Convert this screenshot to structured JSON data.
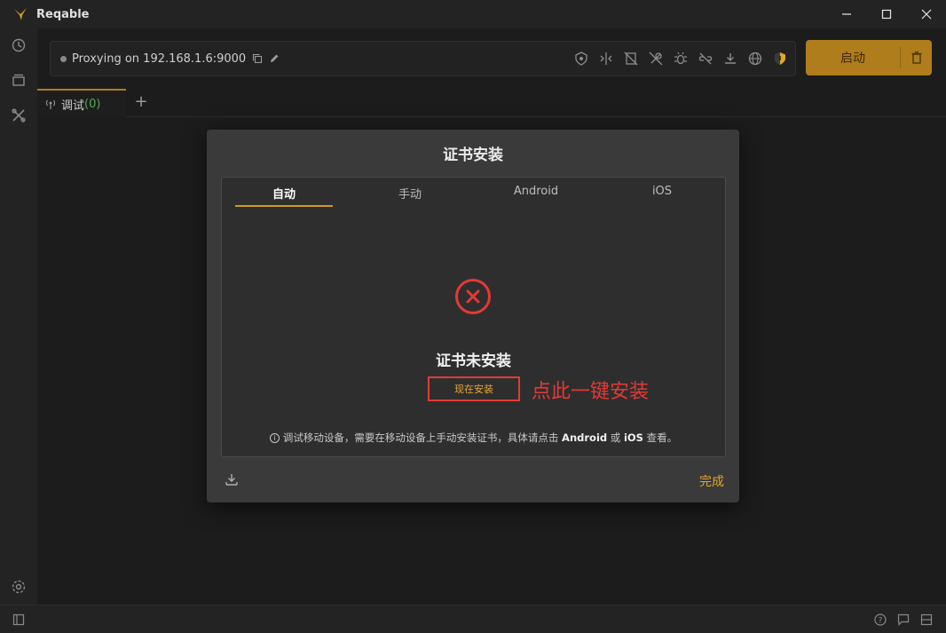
{
  "window": {
    "title": "Reqable",
    "controls": {
      "minimize": "—",
      "maximize": "☐",
      "close": "✕"
    }
  },
  "rail": {
    "icons": [
      "history-icon",
      "layers-icon",
      "tools-icon",
      "settings-icon"
    ]
  },
  "proxy": {
    "status_text": "Proxying on 192.168.1.6:9000",
    "tool_icons": [
      "lock-shield-icon",
      "split-icon",
      "no-cache-icon",
      "no-ssl-icon",
      "bug-icon",
      "link-break-icon",
      "download-icon",
      "globe-icon",
      "shield-warning-icon"
    ]
  },
  "start_button": {
    "label": "启动"
  },
  "tabs": [
    {
      "label": "调试",
      "count": "(0)"
    }
  ],
  "add_tab": "+",
  "dialog": {
    "title": "证书安装",
    "tabs": [
      "自动",
      "手动",
      "Android",
      "iOS"
    ],
    "active_tab": 0,
    "status": "证书未安装",
    "install_button": "现在安装",
    "annotation": "点此一键安装",
    "hint_prefix": "调试移动设备，需要在移动设备上手动安装证书，具体请点击",
    "hint_android": "Android",
    "hint_or": "或",
    "hint_ios": "iOS",
    "hint_suffix": "查看。",
    "done_button": "完成"
  },
  "colors": {
    "accent": "#b07d1c",
    "error": "#e53935",
    "done": "#e0a62c"
  }
}
